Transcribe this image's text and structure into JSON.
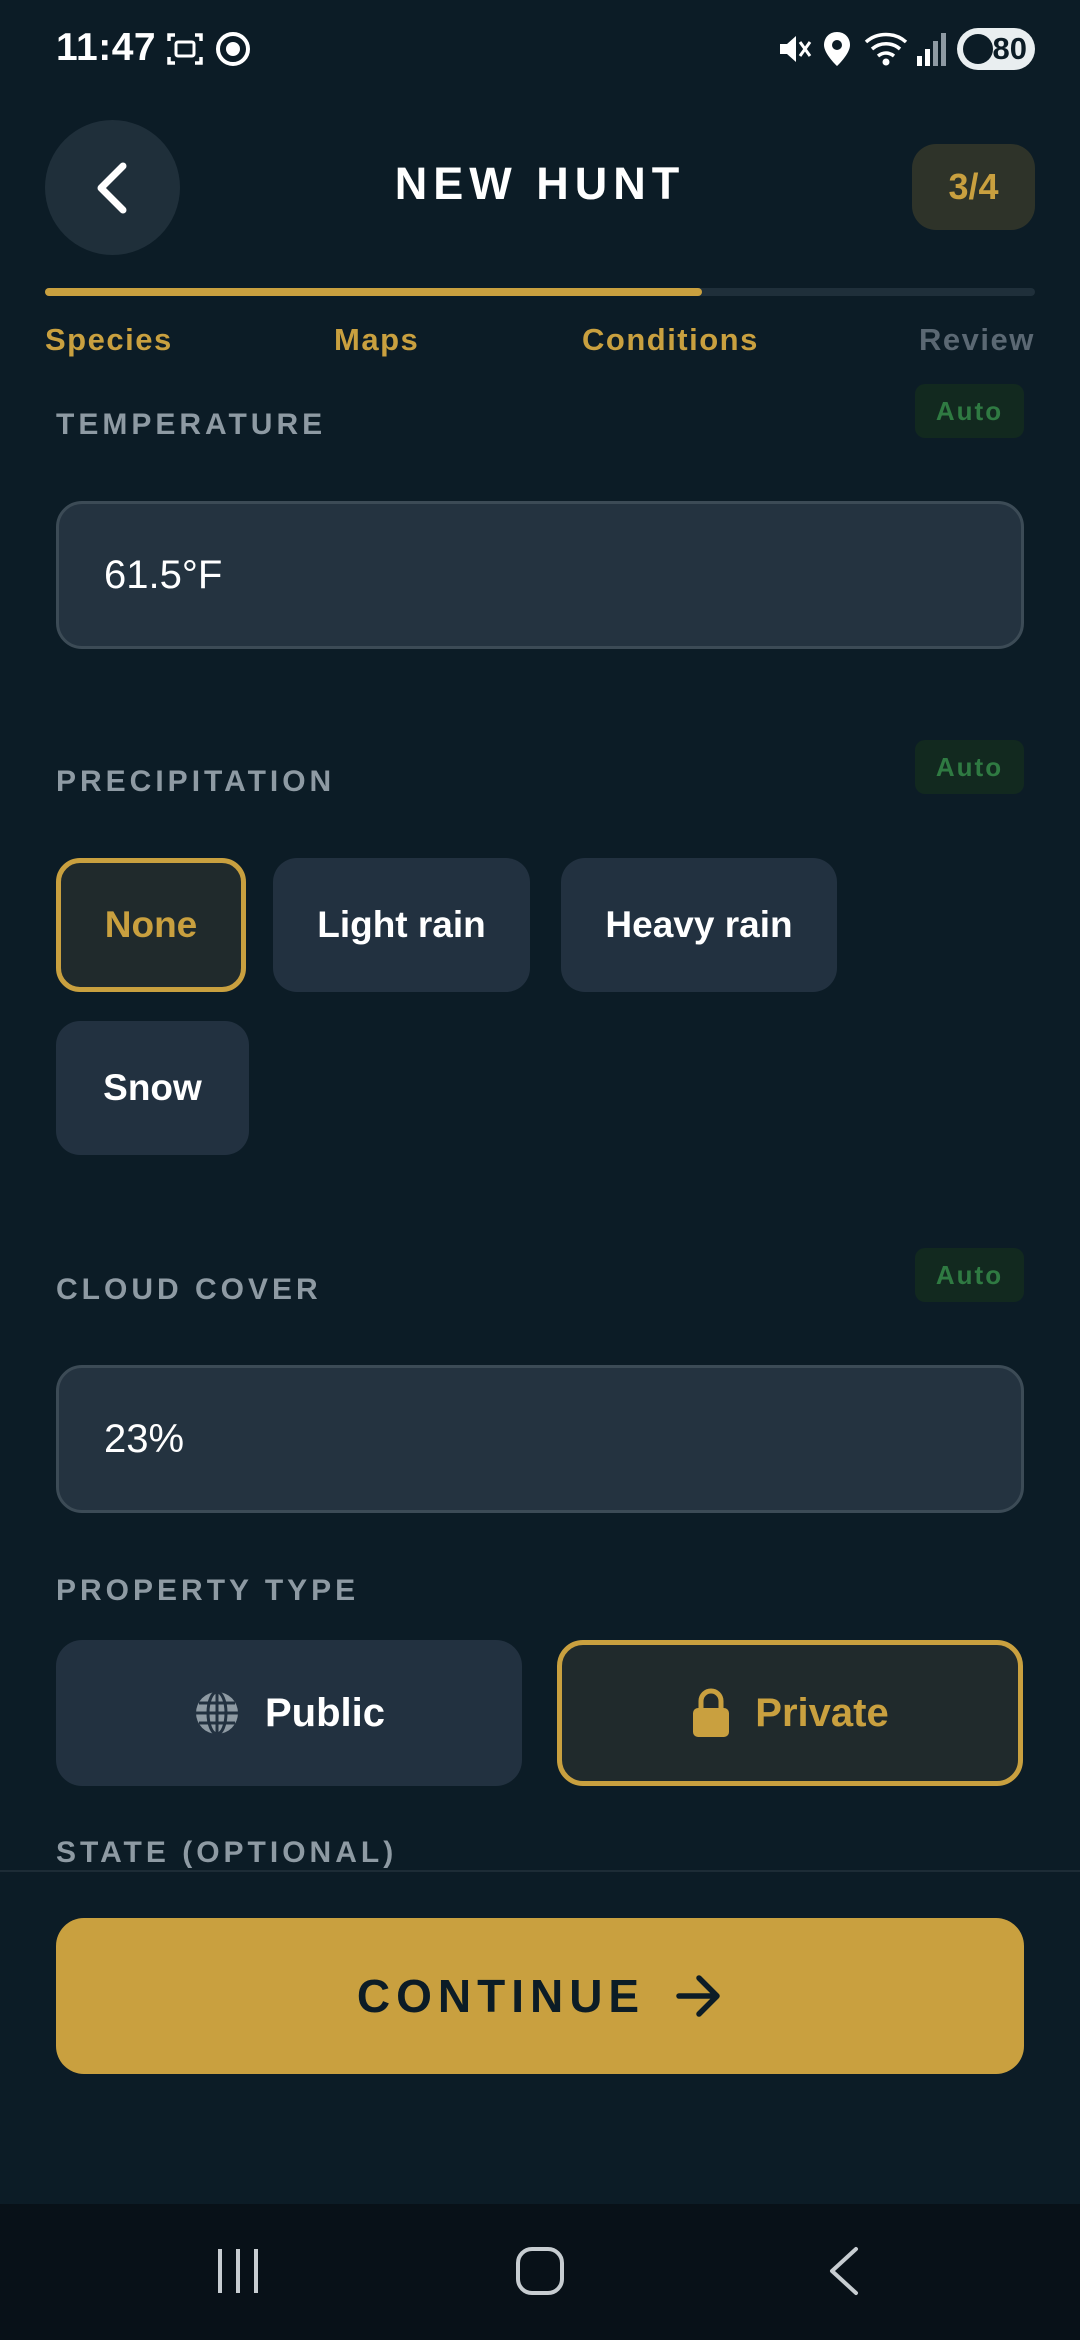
{
  "status_bar": {
    "time": "11:47",
    "battery": "80",
    "icons": [
      "screenshot-icon",
      "record-icon",
      "mute-icon",
      "location-icon",
      "wifi-icon",
      "signal-icon",
      "battery-icon"
    ]
  },
  "header": {
    "title": "NEW HUNT",
    "step": "3/4",
    "progress": 0.75
  },
  "steps": [
    {
      "label": "Species",
      "state": "done"
    },
    {
      "label": "Maps",
      "state": "done"
    },
    {
      "label": "Conditions",
      "state": "active"
    },
    {
      "label": "Review",
      "state": "upcoming"
    }
  ],
  "temperature": {
    "label": "TEMPERATURE",
    "badge": "Auto",
    "value": "61.5°F"
  },
  "precipitation": {
    "label": "PRECIPITATION",
    "badge": "Auto",
    "options": [
      "None",
      "Light rain",
      "Heavy rain",
      "Snow"
    ],
    "selected": "None"
  },
  "cloud_cover": {
    "label": "CLOUD COVER",
    "badge": "Auto",
    "value": "23%"
  },
  "property_type": {
    "label": "PROPERTY TYPE",
    "public_label": "Public",
    "private_label": "Private",
    "selected": "Private"
  },
  "state": {
    "label": "STATE (OPTIONAL)"
  },
  "continue_label": "CONTINUE",
  "colors": {
    "accent": "#c9a03f",
    "background": "#0c1c26",
    "auto_badge": "#2f7a42"
  }
}
